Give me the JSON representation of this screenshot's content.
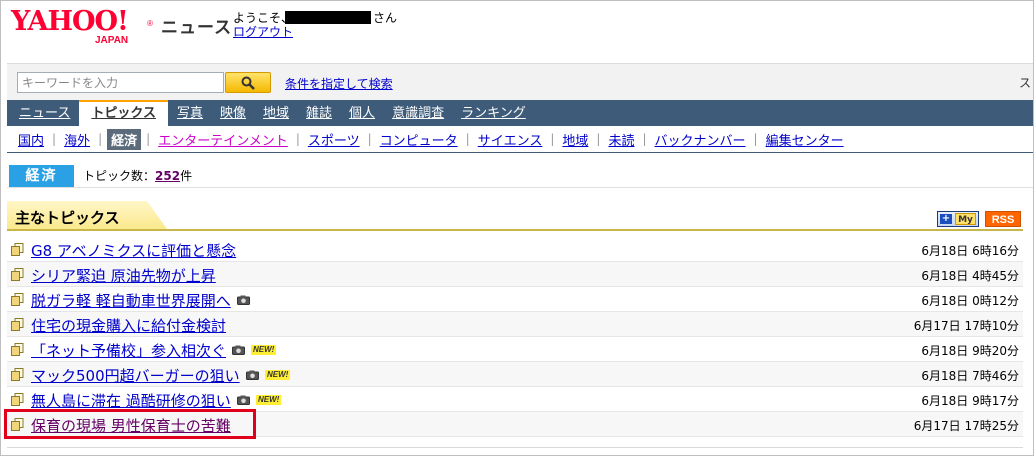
{
  "header": {
    "logo_text": "YAHOO!",
    "logo_sub": "JAPAN",
    "logo_reg": "®",
    "service_name": "ニュース",
    "welcome": "ようこそ、",
    "san": "さん",
    "logout": "ログアウト"
  },
  "search": {
    "placeholder": "キーワードを入力",
    "value": "",
    "advanced_link": "条件を指定して検索",
    "trailing_char": "ス"
  },
  "main_nav": [
    {
      "label": "ニュース",
      "active": false
    },
    {
      "label": "トピックス",
      "active": true
    },
    {
      "label": "写真",
      "active": false
    },
    {
      "label": "映像",
      "active": false
    },
    {
      "label": "地域",
      "active": false
    },
    {
      "label": "雑誌",
      "active": false
    },
    {
      "label": "個人",
      "active": false
    },
    {
      "label": "意識調査",
      "active": false
    },
    {
      "label": "ランキング",
      "active": false
    }
  ],
  "sub_nav": [
    {
      "label": "国内"
    },
    {
      "label": "海外"
    },
    {
      "label": "経済",
      "active": true
    },
    {
      "label": "エンターテインメント"
    },
    {
      "label": "スポーツ"
    },
    {
      "label": "コンピュータ"
    },
    {
      "label": "サイエンス"
    },
    {
      "label": "地域"
    },
    {
      "label": "未読"
    },
    {
      "label": "バックナンバー"
    },
    {
      "label": "編集センター"
    }
  ],
  "category": {
    "label": "経済",
    "count_prefix": "トピック数：",
    "count": "252",
    "count_suffix": "件"
  },
  "section": {
    "title": "主なトピックス",
    "my_label": "My",
    "rss_label": "RSS"
  },
  "topics": [
    {
      "title": "G8 アベノミクスに評価と懸念",
      "date": "6月18日  6時16分"
    },
    {
      "title": "シリア緊迫 原油先物が上昇",
      "date": "6月18日  4時45分"
    },
    {
      "title": "脱ガラ軽 軽自動車世界展開へ",
      "date": "6月18日  0時12分",
      "camera": true
    },
    {
      "title": "住宅の現金購入に給付金検討",
      "date": "6月17日  17時10分"
    },
    {
      "title": "「ネット予備校」参入相次ぐ",
      "date": "6月18日  9時20分",
      "camera": true,
      "new": "NEW!"
    },
    {
      "title": "マック500円超バーガーの狙い",
      "date": "6月18日  7時46分",
      "camera": true,
      "new": "NEW!"
    },
    {
      "title": "無人島に滞在 過酷研修の狙い",
      "date": "6月18日  9時17分",
      "camera": true,
      "new": "NEW!"
    },
    {
      "title": "保育の現場 男性保育士の苦難",
      "date": "6月17日  17時25分",
      "visited": true
    }
  ],
  "colors": {
    "logo_red": "#ff0033",
    "nav_bg": "#3e5c7a",
    "category_blue": "#2aa1e5",
    "highlight_red": "#e0001b",
    "link_blue": "#0000cc"
  },
  "icons": {
    "search": "search-icon",
    "topic": "topic-page-icon",
    "camera": "camera-icon"
  }
}
